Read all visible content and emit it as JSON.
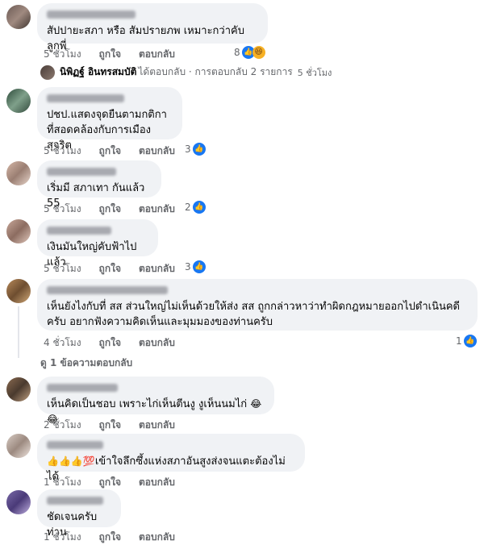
{
  "comments": [
    {
      "text": "สัปปายะสภา หรือ สัมปรายภพ เหมาะกว่าคับ ลูกพี่",
      "time": "5 ชั่วโมง",
      "like_label": "ถูกใจ",
      "reply_label": "ตอบกลับ",
      "reaction_count": "8",
      "reactions": [
        "like-icon",
        "haha-icon"
      ]
    },
    {
      "text": "ปชป.แสดงจุดยืนตามกติกา\nที่สอดคล้องกับการเมืองสุจริต",
      "time": "5 ชั่วโมง",
      "like_label": "ถูกใจ",
      "reply_label": "ตอบกลับ",
      "reaction_count": "3",
      "reactions": [
        "like-icon"
      ]
    },
    {
      "text": "เริ่มมี สภาเทา กันแล้ว 55",
      "time": "5 ชั่วโมง",
      "like_label": "ถูกใจ",
      "reply_label": "ตอบกลับ",
      "reaction_count": "2",
      "reactions": [
        "like-icon"
      ]
    },
    {
      "text": "เงินมันใหญ่คับฟ้าไปแล้ว",
      "time": "5 ชั่วโมง",
      "like_label": "ถูกใจ",
      "reply_label": "ตอบกลับ",
      "reaction_count": "3",
      "reactions": [
        "like-icon"
      ]
    },
    {
      "text": "เห็นยังไงกับที่ สส ส่วนใหญ่ไม่เห็นด้วยให้ส่ง สส ถูกกล่าวหาว่าทำผิดกฎหมายออกไปดำเนินคดี\nครับ อยากฟังความคิดเห็นและมุมมองของท่านครับ",
      "time": "4 ชั่วโมง",
      "like_label": "ถูกใจ",
      "reply_label": "ตอบกลับ",
      "reaction_count": "1",
      "reactions": [
        "like-icon"
      ]
    },
    {
      "text": "เห็นคิดเป็นชอบ เพราะไก่เห็นตีนงู งูเห็นนมไก่",
      "time": "2 ชั่วโมง",
      "like_label": "ถูกใจ",
      "reply_label": "ตอบกลับ",
      "reaction_count": "",
      "reactions": []
    },
    {
      "text": "เข้าใจลึกซึ้งแห่งสภาอันสูงส่งจนแตะต้องไม่ได้",
      "time": "1 ชั่วโมง",
      "like_label": "ถูกใจ",
      "reply_label": "ตอบกลับ",
      "reaction_count": "",
      "reactions": []
    },
    {
      "text": "ชัดเจนครับท่าน",
      "time": "1 ชั่วโมง",
      "like_label": "ถูกใจ",
      "reply_label": "ตอบกลับ",
      "reaction_count": "",
      "reactions": []
    }
  ],
  "reply_summary": {
    "name": "นิพิฏฐ์ อินทรสมบัติ",
    "text": "ได้ตอบกลับ · การตอบกลับ 2 รายการ",
    "time": "5 ชั่วโมง"
  },
  "more_replies": {
    "label": "ดู 1 ข้อความตอบกลับ"
  },
  "emoji_prefix": [
    "thumbs-up",
    "thumbs-up",
    "thumbs-up",
    "hundred-points"
  ],
  "inline_emoji": [
    "cry-laugh-face",
    "cry-laugh-face"
  ],
  "colors": {
    "bubble": "#f0f2f5",
    "meta": "#65676b",
    "like_blue": "#1877f2",
    "text": "#050505"
  }
}
